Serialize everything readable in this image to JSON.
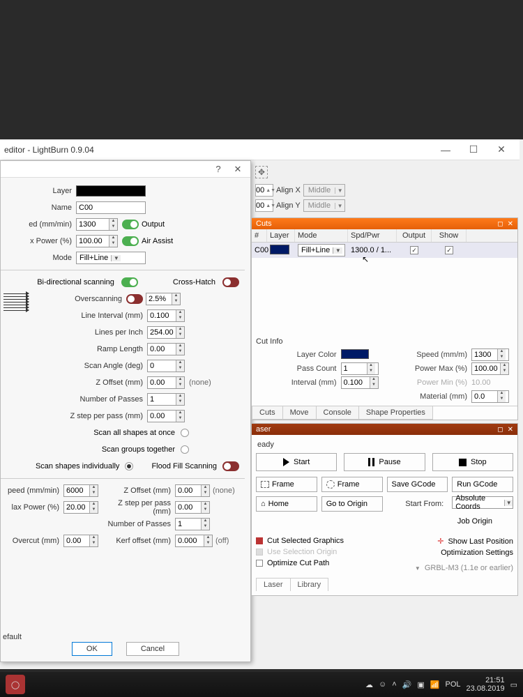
{
  "app": {
    "title": "editor - LightBurn 0.9.04"
  },
  "dialog": {
    "layer_label": "Layer",
    "name_label": "Name",
    "name_value": "C00",
    "speed_label": "ed (mm/min)",
    "speed_value": "1300",
    "power_label": "x Power (%)",
    "power_value": "100.00",
    "output_label": "Output",
    "air_label": "Air Assist",
    "mode_label": "Mode",
    "mode_value": "Fill+Line",
    "bidi_label": "Bi-directional scanning",
    "crosshatch_label": "Cross-Hatch",
    "overscan_label": "Overscanning",
    "overscan_value": "2.5%",
    "lineint_label": "Line Interval (mm)",
    "lineint_value": "0.100",
    "lpi_label": "Lines per Inch",
    "lpi_value": "254.00",
    "ramp_label": "Ramp Length",
    "ramp_value": "0.00",
    "angle_label": "Scan Angle (deg)",
    "angle_value": "0",
    "zoff_label": "Z Offset (mm)",
    "zoff_value": "0.00",
    "zoff_note": "(none)",
    "passes_label": "Number of Passes",
    "passes_value": "1",
    "zstep_label": "Z step per pass (mm)",
    "zstep_value": "0.00",
    "scan_all": "Scan all shapes at once",
    "scan_groups": "Scan groups together",
    "scan_indiv": "Scan shapes individually",
    "flood_label": "Flood Fill Scanning",
    "speed2_label": "peed (mm/min)",
    "speed2_value": "6000",
    "zoff2_label": "Z Offset (mm)",
    "zoff2_value": "0.00",
    "zoff2_note": "(none)",
    "power2_label": "lax Power (%)",
    "power2_value": "20.00",
    "zstep2_label": "Z step per pass (mm)",
    "zstep2_value": "0.00",
    "passes2_label": "Number of Passes",
    "passes2_value": "1",
    "overcut_label": "Overcut (mm)",
    "overcut_value": "0.00",
    "kerf_label": "Kerf offset (mm)",
    "kerf_value": "0.000",
    "kerf_note": "(off)",
    "ok": "OK",
    "cancel": "Cancel",
    "defaults": "efault"
  },
  "align": {
    "x_num": "00",
    "x_label": "Align X",
    "x_value": "Middle",
    "y_num": "00",
    "y_label": "Align Y",
    "y_value": "Middle"
  },
  "cuts": {
    "title": "Cuts",
    "cols": {
      "hash": "#",
      "layer": "Layer",
      "mode": "Mode",
      "spd": "Spd/Pwr",
      "out": "Output",
      "show": "Show"
    },
    "rows": [
      {
        "hash": "C00",
        "mode": "Fill+Line",
        "spd": "1300.0 / 1...",
        "out": true,
        "show": true
      }
    ]
  },
  "cutinfo": {
    "title": "Cut Info",
    "layercolor_label": "Layer Color",
    "speed_label": "Speed (mm/m)",
    "speed_value": "1300",
    "passcount_label": "Pass Count",
    "passcount_value": "1",
    "pmax_label": "Power Max (%)",
    "pmax_value": "100.00",
    "interval_label": "Interval (mm)",
    "interval_value": "0.100",
    "pmin_label": "Power Min (%)",
    "pmin_value": "10.00",
    "material_label": "Material (mm)",
    "material_value": "0.0",
    "tabs": {
      "cuts": "Cuts",
      "move": "Move",
      "console": "Console",
      "shape": "Shape Properties"
    }
  },
  "laser": {
    "title": "aser",
    "status": "eady",
    "start": "Start",
    "pause": "Pause",
    "stop": "Stop",
    "frame": "Frame",
    "frame2": "Frame",
    "savegcode": "Save GCode",
    "rungcode": "Run GCode",
    "home": "Home",
    "origin": "Go to Origin",
    "startfrom_label": "Start From:",
    "startfrom_value": "Absolute Coords",
    "joborigin": "Job Origin",
    "cutsel": "Cut Selected Graphics",
    "usesel": "Use Selection Origin",
    "optpath": "Optimize Cut Path",
    "showlast": "Show Last Position",
    "optset": "Optimization Settings",
    "grbl": "GRBL-M3 (1.1e or earlier)",
    "tab_laser": "Laser",
    "tab_library": "Library"
  },
  "taskbar": {
    "lang": "POL",
    "time": "21:51",
    "date": "23.08.2019"
  }
}
